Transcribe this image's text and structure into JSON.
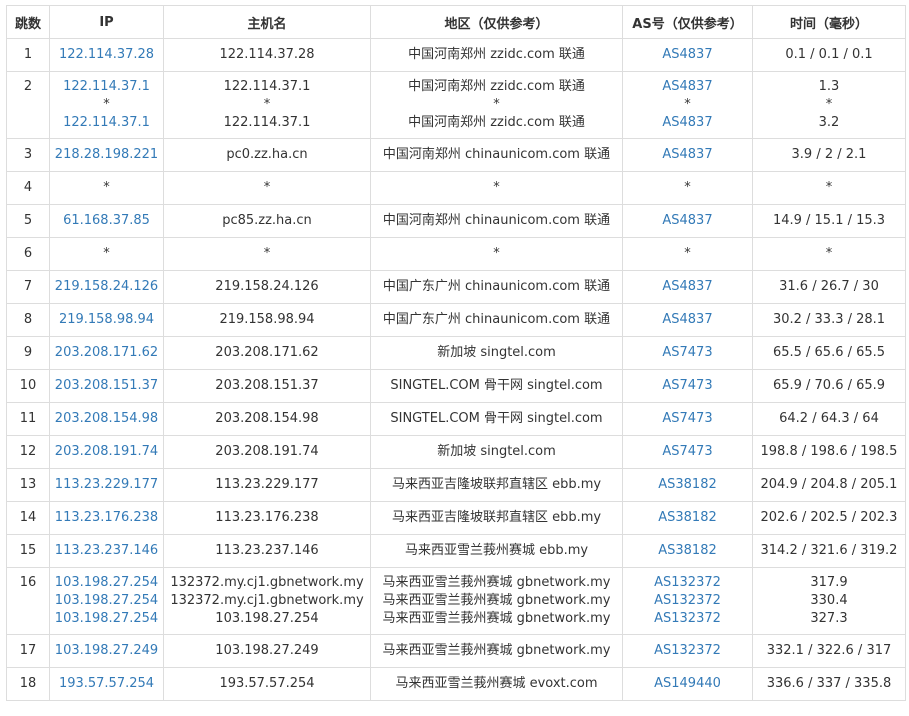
{
  "headers": {
    "hop": "跳数",
    "ip": "IP",
    "host": "主机名",
    "region": "地区（仅供参考）",
    "as": "AS号（仅供参考）",
    "time": "时间（毫秒）"
  },
  "rows": [
    {
      "hop": "1",
      "ip": [
        "122.114.37.28"
      ],
      "host": [
        "122.114.37.28"
      ],
      "region": [
        "中国河南郑州 zzidc.com 联通"
      ],
      "as": [
        "AS4837"
      ],
      "time": [
        "0.1 / 0.1 / 0.1"
      ]
    },
    {
      "hop": "2",
      "ip": [
        "122.114.37.1",
        "*",
        "122.114.37.1"
      ],
      "host": [
        "122.114.37.1",
        "*",
        "122.114.37.1"
      ],
      "region": [
        "中国河南郑州 zzidc.com 联通",
        "*",
        "中国河南郑州 zzidc.com 联通"
      ],
      "as": [
        "AS4837",
        "*",
        "AS4837"
      ],
      "time": [
        "1.3",
        "*",
        "3.2"
      ]
    },
    {
      "hop": "3",
      "ip": [
        "218.28.198.221"
      ],
      "host": [
        "pc0.zz.ha.cn"
      ],
      "region": [
        "中国河南郑州 chinaunicom.com 联通"
      ],
      "as": [
        "AS4837"
      ],
      "time": [
        "3.9 / 2 / 2.1"
      ]
    },
    {
      "hop": "4",
      "ip": [
        "*"
      ],
      "host": [
        "*"
      ],
      "region": [
        "*"
      ],
      "as": [
        "*"
      ],
      "time": [
        "*"
      ]
    },
    {
      "hop": "5",
      "ip": [
        "61.168.37.85"
      ],
      "host": [
        "pc85.zz.ha.cn"
      ],
      "region": [
        "中国河南郑州 chinaunicom.com 联通"
      ],
      "as": [
        "AS4837"
      ],
      "time": [
        "14.9 / 15.1 / 15.3"
      ]
    },
    {
      "hop": "6",
      "ip": [
        "*"
      ],
      "host": [
        "*"
      ],
      "region": [
        "*"
      ],
      "as": [
        "*"
      ],
      "time": [
        "*"
      ]
    },
    {
      "hop": "7",
      "ip": [
        "219.158.24.126"
      ],
      "host": [
        "219.158.24.126"
      ],
      "region": [
        "中国广东广州 chinaunicom.com 联通"
      ],
      "as": [
        "AS4837"
      ],
      "time": [
        "31.6 / 26.7 / 30"
      ]
    },
    {
      "hop": "8",
      "ip": [
        "219.158.98.94"
      ],
      "host": [
        "219.158.98.94"
      ],
      "region": [
        "中国广东广州 chinaunicom.com 联通"
      ],
      "as": [
        "AS4837"
      ],
      "time": [
        "30.2 / 33.3 / 28.1"
      ]
    },
    {
      "hop": "9",
      "ip": [
        "203.208.171.62"
      ],
      "host": [
        "203.208.171.62"
      ],
      "region": [
        "新加坡 singtel.com"
      ],
      "as": [
        "AS7473"
      ],
      "time": [
        "65.5 / 65.6 / 65.5"
      ]
    },
    {
      "hop": "10",
      "ip": [
        "203.208.151.37"
      ],
      "host": [
        "203.208.151.37"
      ],
      "region": [
        "SINGTEL.COM 骨干网 singtel.com"
      ],
      "as": [
        "AS7473"
      ],
      "time": [
        "65.9 / 70.6 / 65.9"
      ]
    },
    {
      "hop": "11",
      "ip": [
        "203.208.154.98"
      ],
      "host": [
        "203.208.154.98"
      ],
      "region": [
        "SINGTEL.COM 骨干网 singtel.com"
      ],
      "as": [
        "AS7473"
      ],
      "time": [
        "64.2 / 64.3 / 64"
      ]
    },
    {
      "hop": "12",
      "ip": [
        "203.208.191.74"
      ],
      "host": [
        "203.208.191.74"
      ],
      "region": [
        "新加坡 singtel.com"
      ],
      "as": [
        "AS7473"
      ],
      "time": [
        "198.8 / 198.6 / 198.5"
      ]
    },
    {
      "hop": "13",
      "ip": [
        "113.23.229.177"
      ],
      "host": [
        "113.23.229.177"
      ],
      "region": [
        "马来西亚吉隆坡联邦直辖区 ebb.my"
      ],
      "as": [
        "AS38182"
      ],
      "time": [
        "204.9 / 204.8 / 205.1"
      ]
    },
    {
      "hop": "14",
      "ip": [
        "113.23.176.238"
      ],
      "host": [
        "113.23.176.238"
      ],
      "region": [
        "马来西亚吉隆坡联邦直辖区 ebb.my"
      ],
      "as": [
        "AS38182"
      ],
      "time": [
        "202.6 / 202.5 / 202.3"
      ]
    },
    {
      "hop": "15",
      "ip": [
        "113.23.237.146"
      ],
      "host": [
        "113.23.237.146"
      ],
      "region": [
        "马来西亚雪兰莪州赛城 ebb.my"
      ],
      "as": [
        "AS38182"
      ],
      "time": [
        "314.2 / 321.6 / 319.2"
      ]
    },
    {
      "hop": "16",
      "ip": [
        "103.198.27.254",
        "103.198.27.254",
        "103.198.27.254"
      ],
      "host": [
        "132372.my.cj1.gbnetwork.my",
        "132372.my.cj1.gbnetwork.my",
        "103.198.27.254"
      ],
      "region": [
        "马来西亚雪兰莪州赛城 gbnetwork.my",
        "马来西亚雪兰莪州赛城 gbnetwork.my",
        "马来西亚雪兰莪州赛城 gbnetwork.my"
      ],
      "as": [
        "AS132372",
        "AS132372",
        "AS132372"
      ],
      "time": [
        "317.9",
        "330.4",
        "327.3"
      ]
    },
    {
      "hop": "17",
      "ip": [
        "103.198.27.249"
      ],
      "host": [
        "103.198.27.249"
      ],
      "region": [
        "马来西亚雪兰莪州赛城 gbnetwork.my"
      ],
      "as": [
        "AS132372"
      ],
      "time": [
        "332.1 / 322.6 / 317"
      ]
    },
    {
      "hop": "18",
      "ip": [
        "193.57.57.254"
      ],
      "host": [
        "193.57.57.254"
      ],
      "region": [
        "马来西亚雪兰莪州赛城 evoxt.com"
      ],
      "as": [
        "AS149440"
      ],
      "time": [
        "336.6 / 337 / 335.8"
      ]
    }
  ]
}
